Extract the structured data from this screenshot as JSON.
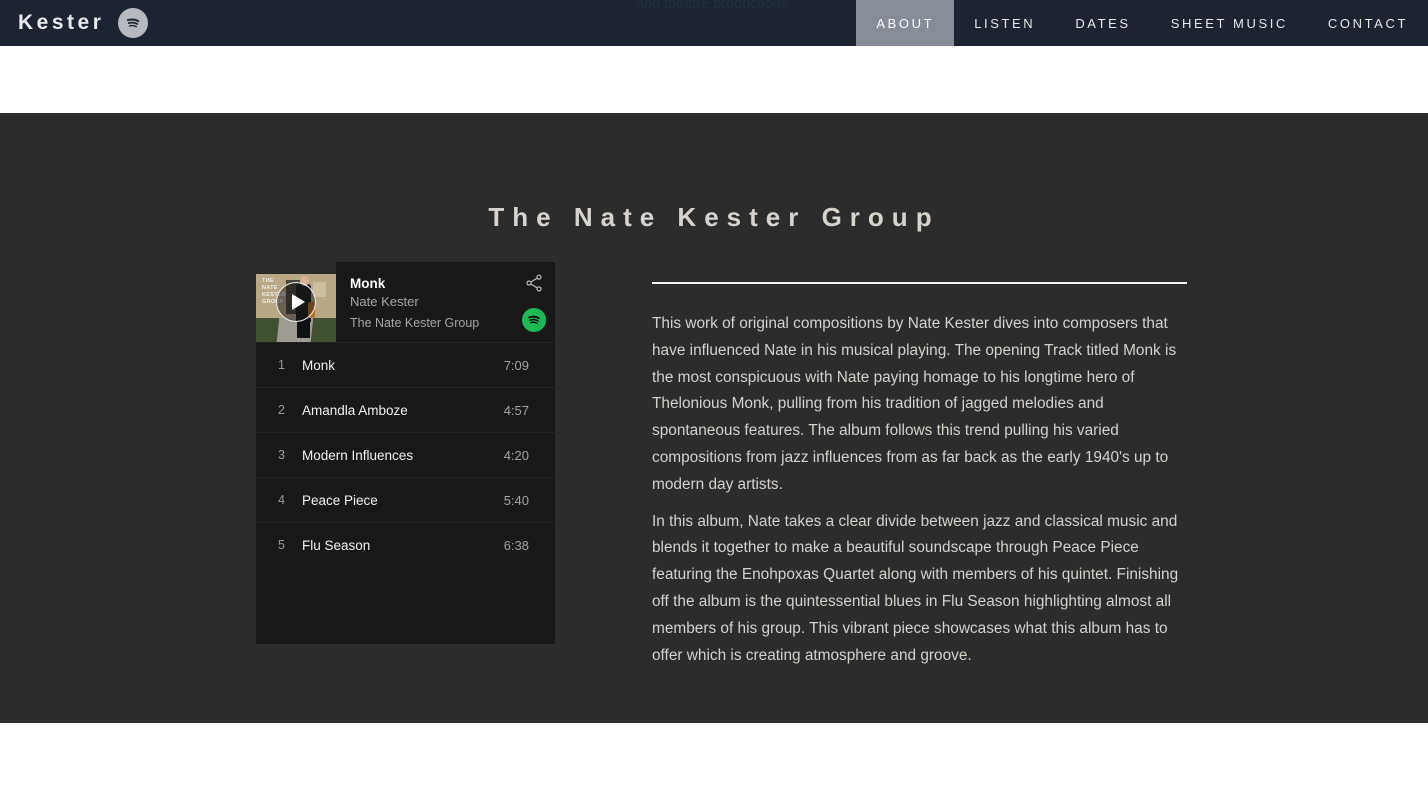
{
  "header": {
    "brand_name": "Kester",
    "brand_icon": "spotify-icon",
    "overlap_text": "and theatre productions.",
    "nav_items": [
      {
        "label": "ABOUT",
        "active": true
      },
      {
        "label": "LISTEN",
        "active": false
      },
      {
        "label": "DATES",
        "active": false
      },
      {
        "label": "SHEET MUSIC",
        "active": false
      },
      {
        "label": "CONTACT",
        "active": false
      }
    ],
    "active_nav_bg": "#868d98",
    "header_bg": "#1c2431"
  },
  "section": {
    "title": "The Nate Kester Group",
    "background": "#2c2c2c"
  },
  "player": {
    "track_title": "Monk",
    "artist": "Nate Kester",
    "album": "The Nate Kester Group",
    "share_icon": "share-icon",
    "spotify_icon": "spotify-icon",
    "play_icon": "play-icon",
    "album_art_caption": "THE NATE KESTER GROUP",
    "accent_green": "#1db954",
    "widget_bg": "#181818",
    "tracks": [
      {
        "number": "1",
        "name": "Monk",
        "duration": "7:09"
      },
      {
        "number": "2",
        "name": "Amandla Amboze",
        "duration": "4:57"
      },
      {
        "number": "3",
        "name": "Modern Influences",
        "duration": "4:20"
      },
      {
        "number": "4",
        "name": "Peace Piece",
        "duration": "5:40"
      },
      {
        "number": "5",
        "name": "Flu Season",
        "duration": "6:38"
      }
    ]
  },
  "description": {
    "paragraph_1": "This work of original compositions by Nate Kester dives into composers that have influenced Nate in his musical playing. The opening Track titled Monk is the most conspicuous with Nate paying homage to his longtime hero of Thelonious Monk, pulling from his tradition of jagged melodies and spontaneous features. The album follows this trend pulling his varied compositions from jazz influences from as far back as the early 1940's up to modern day artists.",
    "paragraph_2": "In this album, Nate takes a clear divide between jazz and classical music and blends it together to make a beautiful soundscape through Peace Piece featuring the Enohpoxas Quartet along with members of his quintet. Finishing off the album is the quintessential blues in Flu Season highlighting almost all members of his group. This vibrant piece showcases what this album has to offer which is creating atmosphere and groove."
  }
}
